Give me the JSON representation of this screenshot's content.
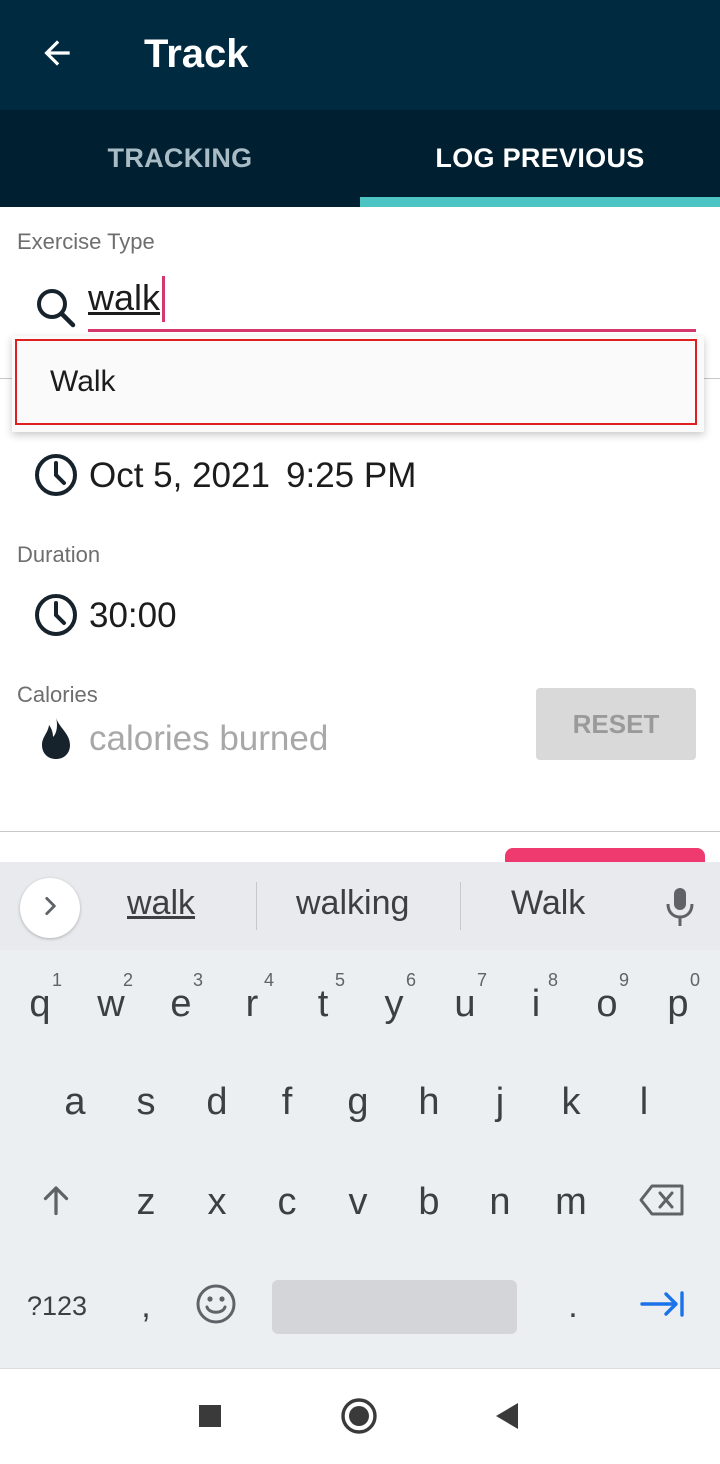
{
  "app_bar": {
    "title": "Track",
    "back_icon": "arrow-left-icon"
  },
  "tabs": [
    {
      "label": "TRACKING",
      "active": false
    },
    {
      "label": "LOG PREVIOUS",
      "active": true
    }
  ],
  "form": {
    "exercise_type": {
      "label": "Exercise Type",
      "value": "walk",
      "icon": "search-icon",
      "suggestion": "Walk"
    },
    "start": {
      "icon": "clock-icon",
      "date": "Oct 5, 2021",
      "time": "9:25 PM"
    },
    "duration": {
      "label": "Duration",
      "value": "30:00",
      "icon": "clock-icon"
    },
    "calories": {
      "label": "Calories",
      "placeholder": "calories burned",
      "icon": "flame-icon"
    },
    "reset_button": "RESET"
  },
  "keyboard": {
    "suggestions": [
      "walk",
      "walking",
      "Walk"
    ],
    "row1": [
      {
        "key": "q",
        "hint": "1"
      },
      {
        "key": "w",
        "hint": "2"
      },
      {
        "key": "e",
        "hint": "3"
      },
      {
        "key": "r",
        "hint": "4"
      },
      {
        "key": "t",
        "hint": "5"
      },
      {
        "key": "y",
        "hint": "6"
      },
      {
        "key": "u",
        "hint": "7"
      },
      {
        "key": "i",
        "hint": "8"
      },
      {
        "key": "o",
        "hint": "9"
      },
      {
        "key": "p",
        "hint": "0"
      }
    ],
    "row2": [
      "a",
      "s",
      "d",
      "f",
      "g",
      "h",
      "j",
      "k",
      "l"
    ],
    "row3": [
      "z",
      "x",
      "c",
      "v",
      "b",
      "n",
      "m"
    ],
    "symbols_key": "?123",
    "comma_key": ",",
    "period_key": ".",
    "enter_color": "#1a73e8"
  },
  "colors": {
    "app_bar": "#002a40",
    "tab_bar": "#001f30",
    "tab_indicator": "#4cc4c4",
    "accent": "#d5396c",
    "highlight_border": "#e02020"
  }
}
